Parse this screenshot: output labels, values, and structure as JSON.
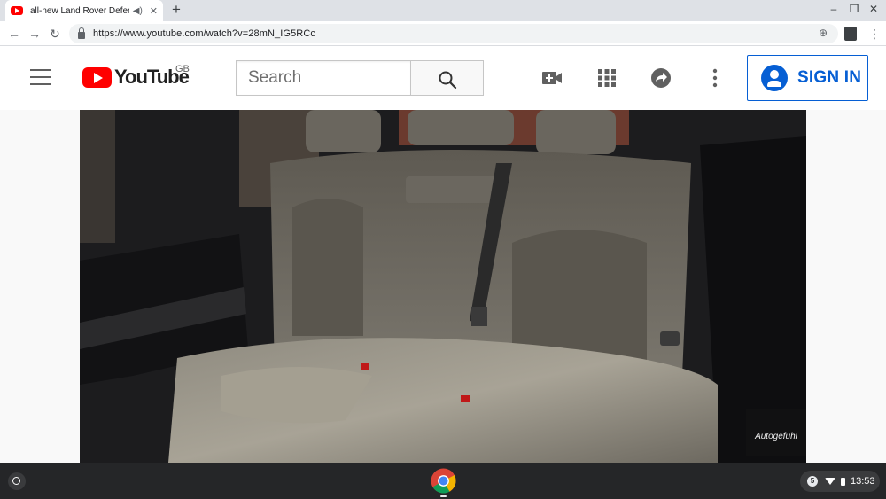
{
  "browser": {
    "tab": {
      "title": "all-new Land Rover Defender",
      "audio_icon": "speaker-icon",
      "close_glyph": "✕"
    },
    "new_tab_glyph": "+",
    "window": {
      "minimize": "–",
      "restore": "❐",
      "close": "✕"
    },
    "nav": {
      "back": "←",
      "forward": "→",
      "reload": "↻"
    },
    "url": "https://www.youtube.com/watch?v=28mN_IG5RCc",
    "menu_glyph": "⋮"
  },
  "youtube": {
    "brand": "YouTube",
    "region": "GB",
    "search": {
      "placeholder": "Search"
    },
    "sign_in_label": "SIGN IN",
    "accent": "#065fd4",
    "brand_red": "#ff0000"
  },
  "video": {
    "watermark": "Autogefühl",
    "content": "car-rear-seat-image"
  },
  "shelf": {
    "notification_count": "5",
    "time": "13:53"
  }
}
